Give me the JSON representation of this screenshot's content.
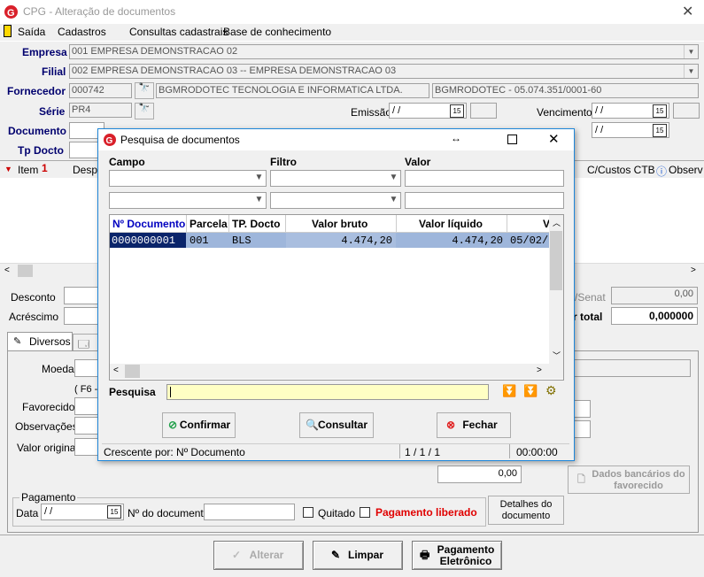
{
  "window": {
    "title": "CPG - Alteração de documentos",
    "close": "✕"
  },
  "menu": [
    "Saída",
    "Cadastros",
    "Consultas cadastrais",
    "Base de conhecimento"
  ],
  "form": {
    "empresa_label": "Empresa",
    "empresa_value": "001 EMPRESA DEMONSTRACAO 02",
    "filial_label": "Filial",
    "filial_value": "002 EMPRESA DEMONSTRACAO 03 -- EMPRESA DEMONSTRACAO 03",
    "fornecedor_label": "Fornecedor",
    "fornecedor_code": "000742",
    "fornecedor_name": "BGMRODOTEC TECNOLOGIA E INFORMATICA LTDA.",
    "fornecedor_cnpj": "BGMRODOTEC - 05.074.351/0001-60",
    "serie_label": "Série",
    "serie_value": "PR4",
    "emissao_label": "Emissão",
    "emissao_value": " / /",
    "vencimento_label": "Vencimento",
    "vencimento_value": " / /",
    "documento_label": "Documento",
    "tpdocto_label": "Tp Docto",
    "original_value": " / /"
  },
  "grid_bg": {
    "item": "Item",
    "desp": "Despe",
    "custos": "C/Custos CTB",
    "obs": "Observ"
  },
  "bottom": {
    "desconto": "Desconto",
    "acrescimo": "Acréscimo",
    "senat": "/Senat",
    "senat_value": "0,00",
    "total_label": "r total",
    "total_value": "0,000000",
    "tab_diversos": "Diversos",
    "moeda": "Moeda",
    "f6": "( F6 -",
    "favorecido": "Favorecido",
    "observacoes": "Observações",
    "valor_original": "Valor original",
    "valor_field": "0,00",
    "dados_bancarios": "Dados bancários do favorecido",
    "pagamento_group": "Pagamento",
    "data_label": "Data",
    "data_value": " / /",
    "ndoc_label": "Nº do documento",
    "quitado": "Quitado",
    "pag_liberado": "Pagamento liberado",
    "detalhes": "Detalhes do documento",
    "alterar": "Alterar",
    "limpar": "Limpar",
    "pag_eletronico": "Pagamento Eletrônico"
  },
  "dialog": {
    "title": "Pesquisa de documentos",
    "campo": "Campo",
    "filtro": "Filtro",
    "valor": "Valor",
    "columns": [
      "Nº Documento",
      "Parcela",
      "TP. Docto",
      "Valor bruto",
      "Valor líquido",
      "V"
    ],
    "rows": [
      {
        "doc": "0000000001",
        "parcela": "001",
        "tp": "BLS",
        "bruto": "4.474,20",
        "liquido": "4.474,20",
        "venc": "05/02/"
      }
    ],
    "pesquisa": "Pesquisa",
    "confirmar": "Confirmar",
    "consultar": "Consultar",
    "fechar": "Fechar",
    "status_sort": "Crescente por: Nº Documento",
    "status_pos": "1 / 1 / 1",
    "status_time": "00:00:00"
  },
  "colors": {
    "brand_red": "#d9202a",
    "label_blue": "#00006e",
    "selection": "#9eb6db"
  }
}
